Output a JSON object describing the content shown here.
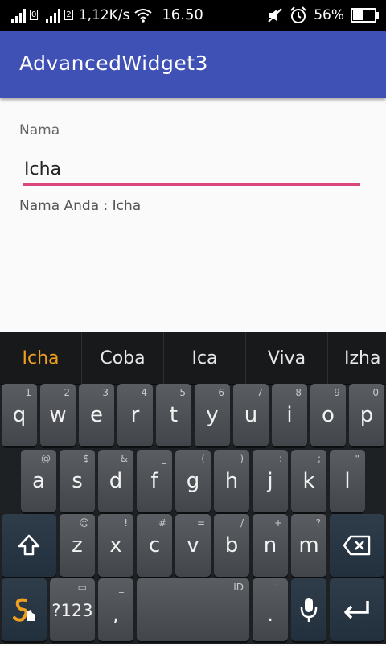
{
  "status_bar": {
    "sim1": "0",
    "sim2": "2",
    "speed": "1,12K/s",
    "time": "16.50",
    "battery": "56%",
    "battery_level": 0.56,
    "icons": [
      "signal-icon",
      "signal-icon",
      "wifi-icon",
      "mute-icon",
      "alarm-icon",
      "battery-icon"
    ]
  },
  "app_bar": {
    "title": "AdvancedWidget3",
    "color": "#3f51b5"
  },
  "form": {
    "label": "Nama",
    "input_value": "Icha",
    "result_text": "Nama Anda : Icha",
    "accent": "#d9467d"
  },
  "keyboard": {
    "suggestions": [
      "Icha",
      "Coba",
      "Ica",
      "Viva",
      "Izha"
    ],
    "row1": [
      {
        "main": "q",
        "hint": "1"
      },
      {
        "main": "w",
        "hint": "2"
      },
      {
        "main": "e",
        "hint": "3"
      },
      {
        "main": "r",
        "hint": "4"
      },
      {
        "main": "t",
        "hint": "5"
      },
      {
        "main": "y",
        "hint": "6"
      },
      {
        "main": "u",
        "hint": "7"
      },
      {
        "main": "i",
        "hint": "8"
      },
      {
        "main": "o",
        "hint": "9"
      },
      {
        "main": "p",
        "hint": "0"
      }
    ],
    "row2": [
      {
        "main": "a",
        "hint": "@"
      },
      {
        "main": "s",
        "hint": "$"
      },
      {
        "main": "d",
        "hint": "&"
      },
      {
        "main": "f",
        "hint": "_"
      },
      {
        "main": "g",
        "hint": "("
      },
      {
        "main": "h",
        "hint": ")"
      },
      {
        "main": "j",
        "hint": ":"
      },
      {
        "main": "k",
        "hint": ";"
      },
      {
        "main": "l",
        "hint": "\""
      }
    ],
    "row3": [
      {
        "main": "z",
        "hint": "☺"
      },
      {
        "main": "x",
        "hint": "!"
      },
      {
        "main": "c",
        "hint": "#"
      },
      {
        "main": "v",
        "hint": "="
      },
      {
        "main": "b",
        "hint": "/"
      },
      {
        "main": "n",
        "hint": "+"
      },
      {
        "main": "m",
        "hint": "?"
      }
    ],
    "symbols_key": "?123",
    "comma_key": ",",
    "comma_hint": "_",
    "space_hint": "ID",
    "period_key": ".",
    "period_hint": "'"
  }
}
